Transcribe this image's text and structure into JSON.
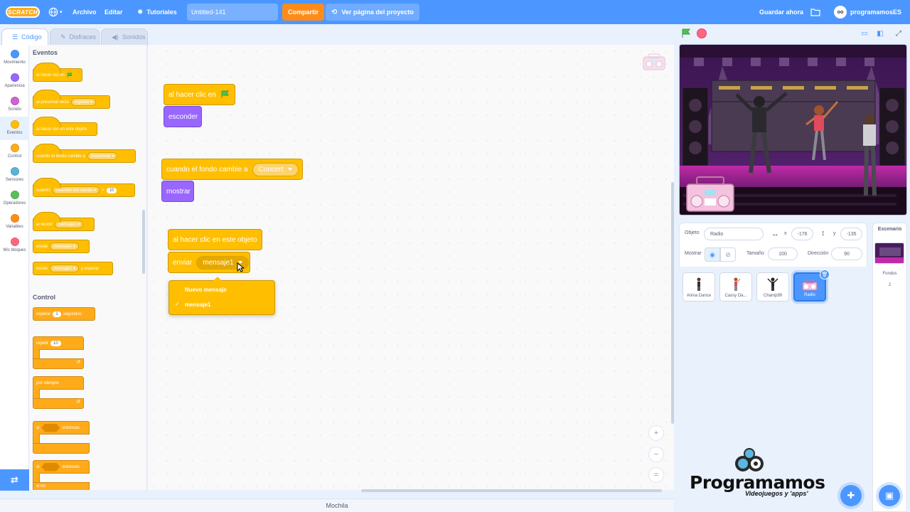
{
  "menubar": {
    "logo": "SCRATCH",
    "archivo": "Archivo",
    "editar": "Editar",
    "tutoriales": "Tutoriales",
    "project_title": "Untitled-141",
    "share": "Compartir",
    "project_page": "Ver página del proyecto",
    "save_now": "Guardar ahora",
    "username": "programamosES",
    "avatar_text": "oo"
  },
  "tabs": [
    {
      "label": "Código"
    },
    {
      "label": "Disfraces"
    },
    {
      "label": "Sonidos"
    }
  ],
  "categories": [
    {
      "label": "Movimiento",
      "color": "#4c97ff"
    },
    {
      "label": "Apariencia",
      "color": "#9966ff"
    },
    {
      "label": "Sonido",
      "color": "#cf63cf"
    },
    {
      "label": "Eventos",
      "color": "#ffbf00"
    },
    {
      "label": "Control",
      "color": "#ffab19"
    },
    {
      "label": "Sensores",
      "color": "#5cb1d6"
    },
    {
      "label": "Operadores",
      "color": "#59c059"
    },
    {
      "label": "Variables",
      "color": "#ff8c1a"
    },
    {
      "label": "Mis bloques",
      "color": "#ff6680"
    }
  ],
  "palette": {
    "events_heading": "Eventos",
    "control_heading": "Control",
    "when_flag": "al hacer clic en",
    "when_key": "al presionar tecla",
    "key_value": "espacio",
    "when_sprite_clicked": "al hacer clic en este objeto",
    "when_backdrop": "cuando el fondo cambie a",
    "backdrop_value": "Boardwalk",
    "when_label": "cuando",
    "loudness": "volumen del sonido",
    "gt": ">",
    "loudness_value": "10",
    "when_receive": "al recibir",
    "message_value": "mensaje1",
    "broadcast": "enviar",
    "broadcast_wait_suffix": "y esperar",
    "wait": "esperar",
    "wait_value": "1",
    "seconds": "segundos",
    "repeat": "repetir",
    "repeat_value": "10",
    "forever": "por siempre",
    "if_label": "si",
    "then_label": "entonces",
    "else_label": "si no"
  },
  "code": {
    "script1_hat": "al hacer clic en",
    "script1_action": "esconder",
    "script2_hat": "cuando el fondo cambie a",
    "script2_value": "Concert",
    "script2_action": "mostrar",
    "script3_hat": "al hacer clic en este objeto",
    "script3_action": "enviar",
    "script3_value": "mensaje1",
    "dropdown_items": [
      "Nuevo mensaje",
      "mensaje1"
    ],
    "dropdown_selected_check": "✓"
  },
  "zoom": {
    "in": "+",
    "out": "−",
    "reset": "="
  },
  "mochila": "Mochila",
  "sprite_info": {
    "sprite_label": "Objeto",
    "sprite_name": "Radio",
    "x_label": "x",
    "x_value": "-176",
    "y_label": "y",
    "y_value": "-135",
    "show_label": "Mostrar",
    "size_label": "Tamaño",
    "size_value": "100",
    "direction_label": "Dirección",
    "direction_value": "90"
  },
  "sprites": [
    {
      "name": "Anina Dance",
      "selected": false
    },
    {
      "name": "Cassy Da...",
      "selected": false
    },
    {
      "name": "Champ99",
      "selected": false
    },
    {
      "name": "Radio",
      "selected": true
    }
  ],
  "stage_panel": {
    "title": "Escenario",
    "backdrops_label": "Fondos",
    "backdrops_count": "2"
  },
  "brand": {
    "name": "Programamos",
    "tagline": "Videojuegos y 'apps'"
  },
  "colors": {
    "accent": "#4c97ff",
    "events": "#ffbf00",
    "looks": "#9966ff",
    "share": "#ff8c1a"
  }
}
